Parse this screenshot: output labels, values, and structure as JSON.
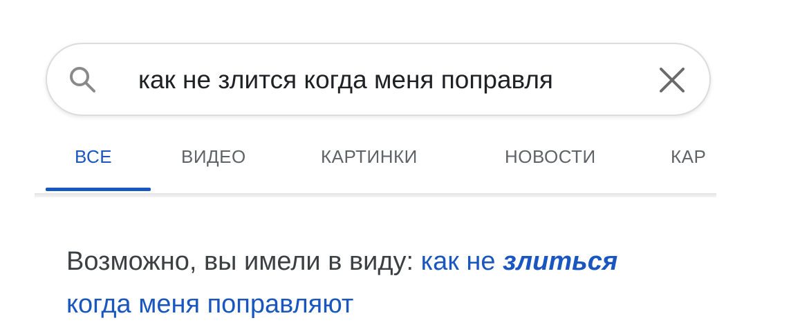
{
  "search": {
    "query": "как не злится когда меня поправля",
    "search_icon": "search-icon",
    "clear_icon": "close-icon"
  },
  "tabs": [
    {
      "label": "ВСЕ",
      "active": true
    },
    {
      "label": "ВИДЕО",
      "active": false
    },
    {
      "label": "КАРТИНКИ",
      "active": false
    },
    {
      "label": "НОВОСТИ",
      "active": false
    },
    {
      "label": "КАР",
      "active": false
    }
  ],
  "suggestion": {
    "prefix": "Возможно, вы имели в виду:",
    "link_part1": "как не",
    "link_corrected": "злиться",
    "link_part2": "когда меня поправляют"
  },
  "colors": {
    "accent": "#1a56c0",
    "text": "#3c4043",
    "tab_inactive": "#5f6368"
  }
}
